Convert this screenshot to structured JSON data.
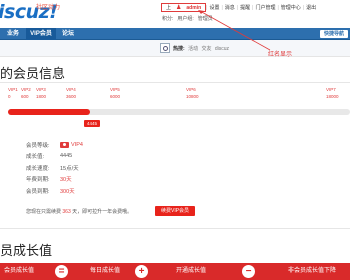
{
  "logo": {
    "text": "iscuz!",
    "subtext": "社区动力"
  },
  "top_nav": {
    "user_badge_prefix": "上",
    "username": "admin",
    "items": [
      "设置",
      "消息",
      "提醒",
      "门户管理",
      "管理中心",
      "退出"
    ],
    "row2": [
      "积分:",
      "用户组:",
      "管理员"
    ]
  },
  "main_nav": {
    "tabs": [
      "业务",
      "VIP会员",
      "论坛"
    ],
    "quick": "快捷导航"
  },
  "search": {
    "hot_label": "热搜:",
    "keywords": [
      "活动",
      "交友",
      "discuz"
    ]
  },
  "section1_title": "的会员信息",
  "levels": [
    {
      "name": "VIP1",
      "value": "0"
    },
    {
      "name": "VIP2",
      "value": "600"
    },
    {
      "name": "VIP3",
      "value": "1800"
    },
    {
      "name": "VIP4",
      "value": "3600"
    },
    {
      "name": "VIP5",
      "value": "6000"
    },
    {
      "name": "VIP6",
      "value": "10800"
    },
    {
      "name": "VIP7",
      "value": "18000"
    }
  ],
  "progress": {
    "fraction": 0.24,
    "tag": "4445"
  },
  "info": [
    {
      "key": "会员等级:",
      "value": "VIP4"
    },
    {
      "key": "成长值:",
      "value": "4445"
    },
    {
      "key": "成长速度:",
      "value": "15点/天"
    },
    {
      "key": "年费到期:",
      "value": "30天"
    },
    {
      "key": "会员到期:",
      "value": "300天"
    }
  ],
  "upgrade": {
    "prefix": "您现在只需续费",
    "days": "363",
    "suffix": "天，即可拉升一年会费哦。",
    "button": "续费VIP会员"
  },
  "section2_title": "员成长值",
  "bottom_bar": [
    "会员成长值",
    "每日成长值",
    "开通成长值",
    "非会员成长值下降"
  ],
  "annotation": "红名显示",
  "colors": {
    "brand_blue": "#2d6fae",
    "accent_red": "#e8231b"
  }
}
